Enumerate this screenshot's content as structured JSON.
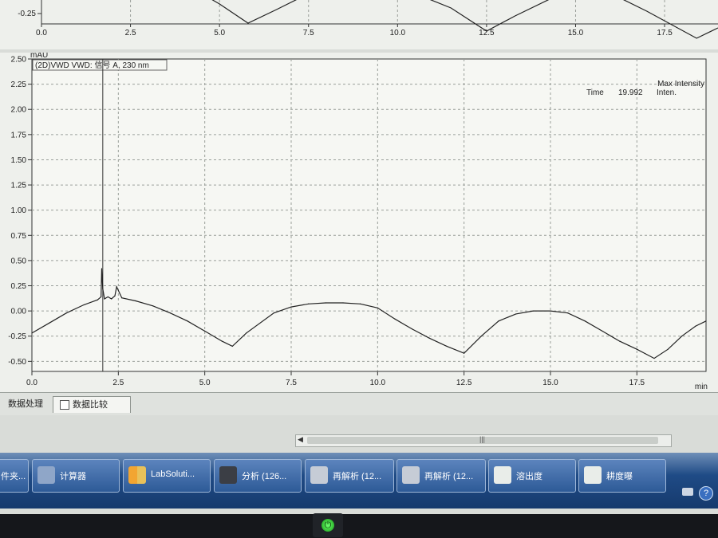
{
  "top_chart": {
    "y_tick_labels": [
      "-0.25"
    ],
    "x_tick_labels": [
      "0.0",
      "2.5",
      "5.0",
      "7.5",
      "10.0",
      "12.5",
      "15.0",
      "17.5"
    ]
  },
  "main_chart": {
    "unit_label": "mAU",
    "legend": "(2D)VWD VWD: 信号 A, 230 nm",
    "max_intensity_label": "Max Intensity",
    "time_label": "Time",
    "time_value": "19.992",
    "inten_label": "Inten.",
    "x_unit": "min"
  },
  "chart_data": {
    "type": "line",
    "title": "",
    "xlabel": "min",
    "ylabel": "mAU",
    "xlim": [
      0,
      19.5
    ],
    "ylim": [
      -0.6,
      2.5
    ],
    "x_ticks": [
      0.0,
      2.5,
      5.0,
      7.5,
      10.0,
      12.5,
      15.0,
      17.5
    ],
    "x_tick_labels": [
      "0.0",
      "2.5",
      "5.0",
      "7.5",
      "10.0",
      "12.5",
      "15.0",
      "17.5"
    ],
    "y_ticks": [
      -0.5,
      -0.25,
      0.0,
      0.25,
      0.5,
      0.75,
      1.0,
      1.25,
      1.5,
      1.75,
      2.0,
      2.25,
      2.5
    ],
    "y_tick_labels": [
      "-0.50",
      "-0.25",
      "0.00",
      "0.25",
      "0.50",
      "0.75",
      "1.00",
      "1.25",
      "1.50",
      "1.75",
      "2.00",
      "2.25",
      "2.50"
    ],
    "grid": true,
    "series": [
      {
        "color": "#222222",
        "x": [
          0.0,
          0.5,
          1.0,
          1.5,
          1.9,
          2.0,
          2.02,
          2.05,
          2.1,
          2.2,
          2.3,
          2.4,
          2.45,
          2.6,
          3.0,
          3.5,
          4.0,
          4.5,
          5.0,
          5.5,
          5.8,
          6.2,
          7.0,
          7.5,
          8.0,
          8.5,
          9.0,
          9.5,
          10.0,
          10.5,
          11.0,
          11.5,
          12.0,
          12.5,
          13.0,
          13.5,
          14.0,
          14.5,
          15.0,
          15.5,
          16.0,
          16.5,
          17.0,
          17.5,
          18.0,
          18.4,
          18.8,
          19.2,
          19.5
        ],
        "y": [
          -0.22,
          -0.12,
          -0.02,
          0.06,
          0.11,
          0.14,
          0.42,
          0.22,
          0.12,
          0.14,
          0.12,
          0.15,
          0.24,
          0.13,
          0.1,
          0.05,
          -0.02,
          -0.1,
          -0.2,
          -0.3,
          -0.35,
          -0.22,
          -0.02,
          0.04,
          0.07,
          0.08,
          0.08,
          0.07,
          0.03,
          -0.08,
          -0.18,
          -0.27,
          -0.35,
          -0.42,
          -0.25,
          -0.1,
          -0.03,
          0.0,
          0.0,
          -0.02,
          -0.1,
          -0.2,
          -0.3,
          -0.38,
          -0.47,
          -0.38,
          -0.25,
          -0.15,
          -0.1
        ]
      }
    ]
  },
  "bottom_tabs": [
    "数据处理",
    "数据比较"
  ],
  "taskbar": {
    "items": [
      {
        "label": "件夹..."
      },
      {
        "label": "计算器"
      },
      {
        "label": "LabSoluti..."
      },
      {
        "label": "分析 (126..."
      },
      {
        "label": "再解析 (12..."
      },
      {
        "label": "再解析 (12..."
      },
      {
        "label": "溶出度"
      },
      {
        "label": "耕度曝"
      }
    ],
    "help": "?"
  }
}
